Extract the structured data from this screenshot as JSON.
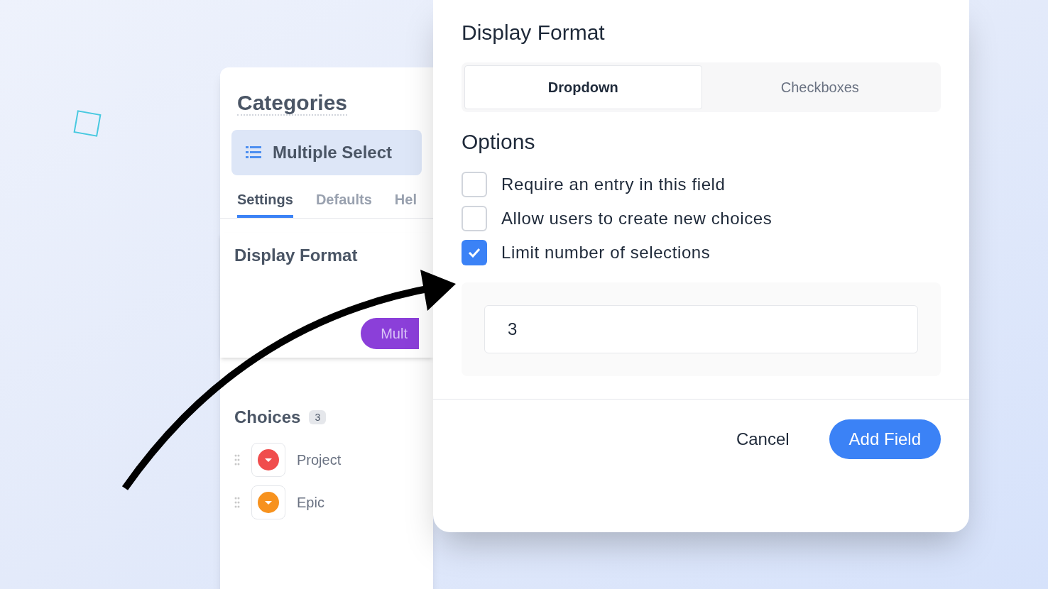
{
  "back_card": {
    "title": "Categories",
    "field_type": "Multiple Select",
    "tabs": [
      {
        "label": "Settings",
        "selected": true
      },
      {
        "label": "Defaults",
        "selected": false
      },
      {
        "label": "Hel",
        "selected": false
      }
    ],
    "section": "Display Format",
    "pill": "Mult",
    "choices_title": "Choices",
    "choices_count": "3",
    "choices": [
      {
        "label": "Project",
        "color": "#f04d4d"
      },
      {
        "label": "Epic",
        "color": "#f7921e"
      }
    ]
  },
  "dialog": {
    "section": "Display Format",
    "formats": [
      {
        "label": "Dropdown",
        "selected": true
      },
      {
        "label": "Checkboxes",
        "selected": false
      }
    ],
    "options_title": "Options",
    "options": [
      {
        "label": "Require an entry in this field",
        "checked": false
      },
      {
        "label": "Allow users to create new choices",
        "checked": false
      },
      {
        "label": "Limit number of selections",
        "checked": true
      }
    ],
    "limit_value": "3",
    "buttons": [
      {
        "label": "Cancel",
        "kind": "secondary"
      },
      {
        "label": "Add Field",
        "kind": "primary"
      }
    ]
  }
}
